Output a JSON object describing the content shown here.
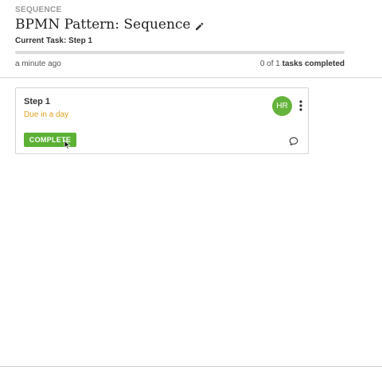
{
  "header": {
    "breadcrumb": "SEQUENCE",
    "title": "BPMN Pattern: Sequence",
    "current_task": "Current Task: Step 1",
    "progress_fraction": 0,
    "updated": "a minute ago",
    "tasks_count_prefix": "0 of 1",
    "tasks_count_suffix": "tasks completed"
  },
  "card": {
    "title": "Step 1",
    "due": "Due in a day",
    "avatar_initials": "HR",
    "complete_label": "COMPLETE"
  },
  "colors": {
    "accent_green": "#5cb135",
    "due_orange": "#e0a321",
    "avatar_green": "#64b33c"
  },
  "icons": {
    "edit": "pencil-icon",
    "menu": "more-vertical-icon",
    "comment": "comment-icon",
    "cursor": "mouse-pointer"
  }
}
